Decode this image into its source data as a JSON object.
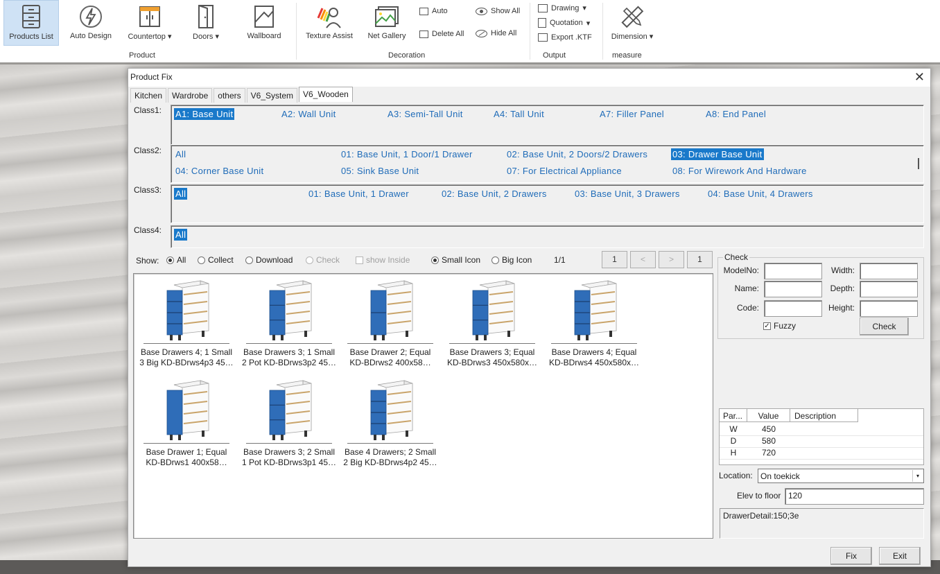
{
  "ribbon": {
    "products_list": "Products List",
    "auto_design": "Auto Design",
    "countertop": "Countertop",
    "doors": "Doors",
    "wallboard": "Wallboard",
    "texture_assist": "Texture Assist",
    "net_gallery": "Net Gallery",
    "auto": "Auto",
    "delete_all": "Delete All",
    "show_all": "Show All",
    "hide_all": "Hide All",
    "drawing": "Drawing",
    "quotation": "Quotation",
    "export_ktf": "Export .KTF",
    "dimension": "Dimension",
    "group_product": "Product",
    "group_decoration": "Decoration",
    "group_output": "Output",
    "group_measure": "measure",
    "dropdown_marker": "▾"
  },
  "dialog": {
    "title": "Product Fix",
    "close": "✕",
    "tabs": [
      "Kitchen",
      "Wardrobe",
      "others",
      "V6_System",
      "V6_Wooden"
    ],
    "class1_label": "Class1:",
    "class2_label": "Class2:",
    "class3_label": "Class3:",
    "class4_label": "Class4:",
    "class1": [
      "A1: Base Unit",
      "A2: Wall Unit",
      "A3: Semi-Tall Unit",
      "A4: Tall Unit",
      "A7: Filler Panel",
      "A8: End Panel"
    ],
    "class2": [
      "All",
      "01: Base Unit, 1 Door/1 Drawer",
      "02: Base Unit, 2 Doors/2 Drawers",
      "03: Drawer Base Unit",
      "04: Corner Base Unit",
      "05: Sink Base Unit",
      "07: For Electrical Appliance",
      "08: For Wirework And Hardware"
    ],
    "class3": [
      "All",
      "01: Base Unit, 1 Drawer",
      "02: Base Unit, 2 Drawers",
      "03: Base Unit, 3 Drawers",
      "04: Base Unit, 4 Drawers"
    ],
    "class4": [
      "All"
    ],
    "show_label": "Show:",
    "show_all": "All",
    "collect": "Collect",
    "download": "Download",
    "check_opt": "Check",
    "show_inside": "show Inside",
    "small_icon": "Small Icon",
    "big_icon": "Big Icon",
    "page_info": "1/1",
    "page_first": "1",
    "page_prev": "<",
    "page_next": ">",
    "page_last": "1",
    "products": [
      {
        "l1": "Base Drawers 4; 1 Small",
        "l2": "3 Big KD-BDrws4p3 45…",
        "drawers": 4
      },
      {
        "l1": "Base Drawers 3; 1 Small",
        "l2": "2 Pot KD-BDrws3p2 45…",
        "drawers": 3
      },
      {
        "l1": "Base Drawer 2; Equal",
        "l2": "KD-BDrws2 400x58…",
        "drawers": 2
      },
      {
        "l1": "Base Drawers 3; Equal",
        "l2": "KD-BDrws3 450x580x…",
        "drawers": 3
      },
      {
        "l1": "Base Drawers 4; Equal",
        "l2": "KD-BDrws4 450x580x…",
        "drawers": 4
      },
      {
        "l1": "Base Drawer 1; Equal",
        "l2": "KD-BDrws1 400x58…",
        "drawers": 1
      },
      {
        "l1": "Base Drawers 3; 2 Small",
        "l2": "1 Pot KD-BDrws3p1 45…",
        "drawers": 3
      },
      {
        "l1": "Base 4 Drawers; 2 Small",
        "l2": "2 Big KD-BDrws4p2 45…",
        "drawers": 4
      }
    ],
    "check": {
      "legend": "Check",
      "model_no": "ModelNo:",
      "name": "Name:",
      "code": "Code:",
      "width": "Width:",
      "depth": "Depth:",
      "height": "Height:",
      "fuzzy": "Fuzzy",
      "fuzzy_mark": "✓",
      "button": "Check"
    },
    "params": {
      "headers": [
        "Par...",
        "Value",
        "Description"
      ],
      "rows": [
        {
          "par": "W",
          "value": "450",
          "desc": ""
        },
        {
          "par": "D",
          "value": "580",
          "desc": ""
        },
        {
          "par": "H",
          "value": "720",
          "desc": ""
        }
      ]
    },
    "location_label": "Location:",
    "location_value": "On toekick",
    "elev_label": "Elev to floor",
    "elev_value": "120",
    "info": "DrawerDetail:150;3e",
    "fix": "Fix",
    "exit": "Exit"
  },
  "colors": {
    "accent_blue": "#1979ca",
    "link_blue": "#1e6bb8",
    "drawer_blue": "#2f6db8"
  }
}
